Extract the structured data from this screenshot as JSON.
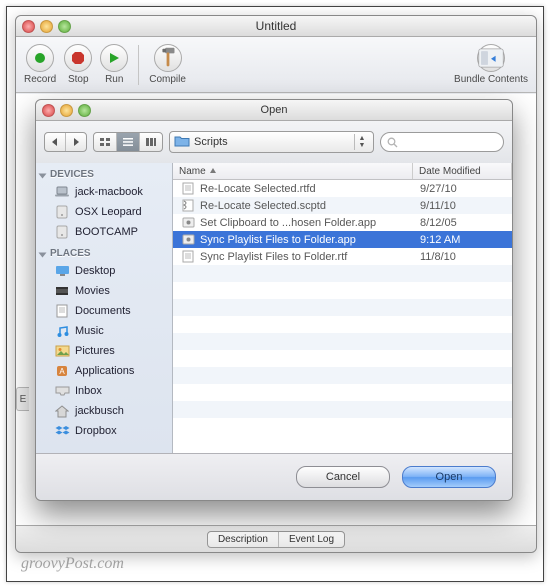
{
  "main_window": {
    "title": "Untitled",
    "toolbar": {
      "record": "Record",
      "stop": "Stop",
      "run": "Run",
      "compile": "Compile",
      "bundle_contents": "Bundle Contents"
    },
    "bottom_tabs": {
      "description": "Description",
      "event_log": "Event Log"
    },
    "edge_tab": "E"
  },
  "dialog": {
    "title": "Open",
    "folder": "Scripts",
    "search_placeholder": "",
    "sidebar": {
      "devices_header": "DEVICES",
      "devices": [
        {
          "label": "jack-macbook",
          "icon": "laptop"
        },
        {
          "label": "OSX Leopard",
          "icon": "disk"
        },
        {
          "label": "BOOTCAMP",
          "icon": "disk"
        }
      ],
      "places_header": "PLACES",
      "places": [
        {
          "label": "Desktop",
          "icon": "desktop"
        },
        {
          "label": "Movies",
          "icon": "movies"
        },
        {
          "label": "Documents",
          "icon": "documents"
        },
        {
          "label": "Music",
          "icon": "music"
        },
        {
          "label": "Pictures",
          "icon": "pictures"
        },
        {
          "label": "Applications",
          "icon": "apps"
        },
        {
          "label": "Inbox",
          "icon": "inbox"
        },
        {
          "label": "jackbusch",
          "icon": "home"
        },
        {
          "label": "Dropbox",
          "icon": "dropbox"
        }
      ]
    },
    "columns": {
      "name": "Name",
      "date": "Date Modified"
    },
    "files": [
      {
        "name": "Re-Locate Selected.rtfd",
        "date": "9/27/10",
        "icon": "rtf",
        "selected": false
      },
      {
        "name": "Re-Locate Selected.scptd",
        "date": "9/11/10",
        "icon": "script",
        "selected": false
      },
      {
        "name": "Set Clipboard to ...hosen Folder.app",
        "date": "8/12/05",
        "icon": "app",
        "selected": false
      },
      {
        "name": "Sync Playlist Files to Folder.app",
        "date": "9:12 AM",
        "icon": "app",
        "selected": true
      },
      {
        "name": "Sync Playlist Files to Folder.rtf",
        "date": "11/8/10",
        "icon": "rtf",
        "selected": false
      }
    ],
    "buttons": {
      "cancel": "Cancel",
      "open": "Open"
    }
  },
  "watermark": "groovyPost.com"
}
